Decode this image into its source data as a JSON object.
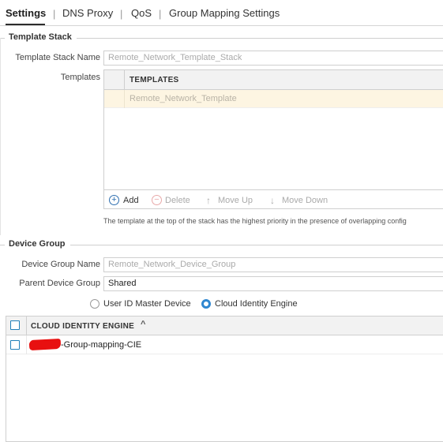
{
  "tabs": [
    {
      "label": "Settings",
      "active": true
    },
    {
      "label": "DNS Proxy",
      "active": false
    },
    {
      "label": "QoS",
      "active": false
    },
    {
      "label": "Group Mapping Settings",
      "active": false
    }
  ],
  "template_stack": {
    "section_title": "Template Stack",
    "name_label": "Template Stack Name",
    "name_value": "Remote_Network_Template_Stack",
    "templates_label": "Templates",
    "grid_header": "TEMPLATES",
    "rows": [
      "Remote_Network_Template"
    ],
    "toolbar": {
      "add": "Add",
      "delete": "Delete",
      "move_up": "Move Up",
      "move_down": "Move Down"
    },
    "note": "The template at the top of the stack has the highest priority in the presence of overlapping config"
  },
  "device_group": {
    "section_title": "Device Group",
    "name_label": "Device Group Name",
    "name_value": "Remote_Network_Device_Group",
    "parent_label": "Parent Device Group",
    "parent_value": "Shared",
    "radio_user_id": "User ID Master Device",
    "radio_cie": "Cloud Identity Engine",
    "selected": "Cloud Identity Engine"
  },
  "cie_table": {
    "header": "CLOUD IDENTITY ENGINE",
    "sort": "ascending",
    "rows": [
      "-Group-mapping-CIE"
    ]
  },
  "colors": {
    "accent_blue": "#2f87d0",
    "selected_row_bg": "#fdf5e2",
    "redaction": "#e81010"
  }
}
